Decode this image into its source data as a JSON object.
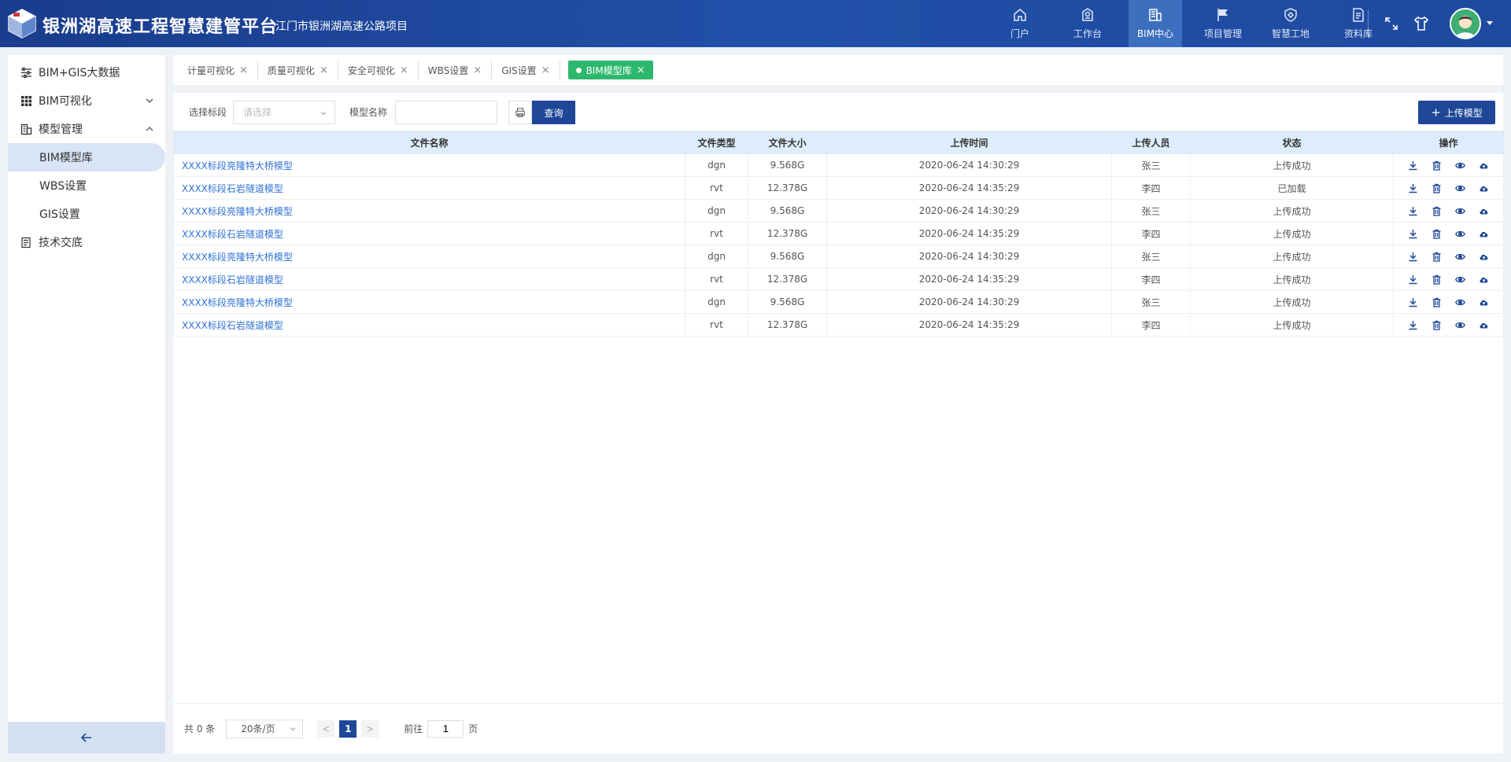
{
  "header": {
    "brand": "银洲湖高速工程智慧建管平台",
    "subtitle": "江门市银洲湖高速公路项目",
    "nav": [
      {
        "label": "门户",
        "icon": "home-icon"
      },
      {
        "label": "工作台",
        "icon": "workbench-icon"
      },
      {
        "label": "BIM中心",
        "icon": "building-icon"
      },
      {
        "label": "项目管理",
        "icon": "flag-icon"
      },
      {
        "label": "智慧工地",
        "icon": "shield-icon"
      },
      {
        "label": "资料库",
        "icon": "document-icon"
      }
    ],
    "active_nav": "BIM中心"
  },
  "sidebar": {
    "items": [
      {
        "label": "BIM+GIS大数据",
        "icon": "sliders-icon"
      },
      {
        "label": "BIM可视化",
        "icon": "grid-icon"
      },
      {
        "label": "模型管理",
        "icon": "model-icon"
      }
    ],
    "sub_items": [
      {
        "label": "BIM模型库"
      },
      {
        "label": "WBS设置"
      },
      {
        "label": "GIS设置"
      }
    ],
    "last_item": {
      "label": "技术交底",
      "icon": "note-icon"
    }
  },
  "tabs": [
    {
      "label": "计量可视化"
    },
    {
      "label": "质量可视化"
    },
    {
      "label": "安全可视化"
    },
    {
      "label": "WBS设置"
    },
    {
      "label": "GIS设置"
    },
    {
      "label": "BIM模型库"
    }
  ],
  "filter": {
    "section_label": "选择标段",
    "section_placeholder": "请选择",
    "name_label": "模型名称",
    "name_value": "",
    "query_label": "查询",
    "upload_label": "上传模型"
  },
  "table": {
    "headers": [
      "文件名称",
      "文件类型",
      "文件大小",
      "上传时间",
      "上传人员",
      "状态",
      "操作"
    ],
    "rows": [
      {
        "name": "XXXX标段亮隆特大桥模型",
        "type": "dgn",
        "size": "9.568G",
        "time": "2020-06-24 14:30:29",
        "user": "张三",
        "status": "上传成功"
      },
      {
        "name": "XXXX标段石岩隧道模型",
        "type": "rvt",
        "size": "12.378G",
        "time": "2020-06-24 14:35:29",
        "user": "李四",
        "status": "已加载"
      },
      {
        "name": "XXXX标段亮隆特大桥模型",
        "type": "dgn",
        "size": "9.568G",
        "time": "2020-06-24 14:30:29",
        "user": "张三",
        "status": "上传成功"
      },
      {
        "name": "XXXX标段石岩隧道模型",
        "type": "rvt",
        "size": "12.378G",
        "time": "2020-06-24 14:35:29",
        "user": "李四",
        "status": "上传成功"
      },
      {
        "name": "XXXX标段亮隆特大桥模型",
        "type": "dgn",
        "size": "9.568G",
        "time": "2020-06-24 14:30:29",
        "user": "张三",
        "status": "上传成功"
      },
      {
        "name": "XXXX标段石岩隧道模型",
        "type": "rvt",
        "size": "12.378G",
        "time": "2020-06-24 14:35:29",
        "user": "李四",
        "status": "上传成功"
      },
      {
        "name": "XXXX标段亮隆特大桥模型",
        "type": "dgn",
        "size": "9.568G",
        "time": "2020-06-24 14:30:29",
        "user": "张三",
        "status": "上传成功"
      },
      {
        "name": "XXXX标段石岩隧道模型",
        "type": "rvt",
        "size": "12.378G",
        "time": "2020-06-24 14:35:29",
        "user": "李四",
        "status": "上传成功"
      }
    ],
    "row_actions": [
      "download-icon",
      "delete-icon",
      "view-icon",
      "cloud-upload-icon"
    ]
  },
  "pager": {
    "total": "共 0 条",
    "page_size": "20条/页",
    "prev": "<",
    "current": "1",
    "next": ">",
    "goto_label": "前往",
    "goto_value": "1",
    "page_suffix": "页"
  },
  "colors": {
    "header_bg": "#1f4aa0",
    "primary": "#1e4797",
    "active_tab": "#2db86e",
    "link": "#2f72d4",
    "table_header": "#deedfb"
  }
}
